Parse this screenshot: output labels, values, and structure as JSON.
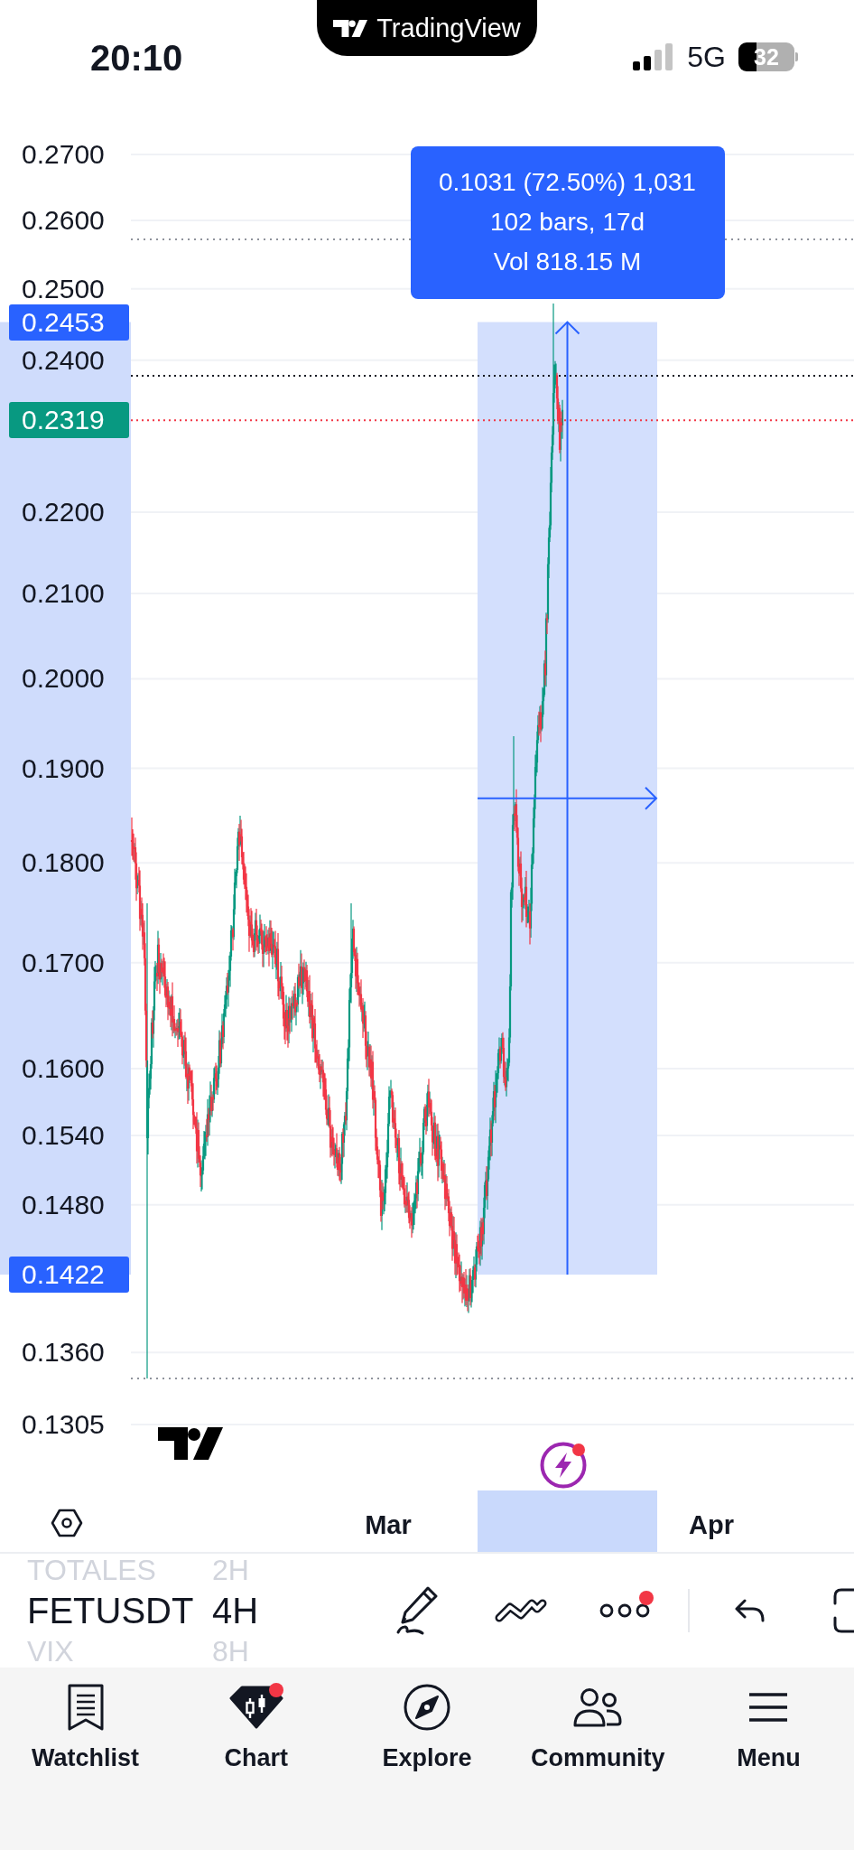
{
  "status_bar": {
    "time": "20:10",
    "app_name": "TradingView",
    "network": "5G",
    "battery": "32"
  },
  "chart": {
    "price_axis": [
      "0.2700",
      "0.2600",
      "0.2500",
      "0.2400",
      "0.2200",
      "0.2100",
      "0.2000",
      "0.1900",
      "0.1800",
      "0.1700",
      "0.1600",
      "0.1540",
      "0.1480",
      "0.1360",
      "0.1305"
    ],
    "price_badges": [
      {
        "label": "0.2453",
        "kind": "range",
        "color": "#2962ff"
      },
      {
        "label": "0.2319",
        "kind": "last",
        "color": "#089981"
      },
      {
        "label": "0.1422",
        "kind": "range",
        "color": "#2962ff"
      }
    ],
    "measure_tooltip": [
      "0.1031 (72.50%) 1,031",
      "102 bars, 17d",
      "Vol 818.15 M"
    ],
    "alerts": {
      "notification": true
    }
  },
  "time_axis": [
    "Mar",
    "Apr"
  ],
  "symbol_bar": {
    "symbols": [
      {
        "label": "TOTALES",
        "selected": false
      },
      {
        "label": "FETUSDT",
        "selected": true
      },
      {
        "label": "VIX",
        "selected": false
      }
    ],
    "intervals": [
      {
        "label": "2H",
        "selected": false
      },
      {
        "label": "4H",
        "selected": true
      },
      {
        "label": "8H",
        "selected": false
      }
    ],
    "tools": [
      {
        "kind": "draw",
        "notification": false
      },
      {
        "kind": "trend",
        "notification": false
      },
      {
        "kind": "more",
        "notification": true
      },
      {
        "kind": "undo",
        "notification": false
      },
      {
        "kind": "fullscreen",
        "notification": false
      }
    ]
  },
  "tab_bar": [
    {
      "label": "Watchlist",
      "selected": false,
      "notification": false
    },
    {
      "label": "Chart",
      "selected": true,
      "notification": true
    },
    {
      "label": "Explore",
      "selected": false,
      "notification": false
    },
    {
      "label": "Community",
      "selected": false,
      "notification": false
    },
    {
      "label": "Menu",
      "selected": false,
      "notification": false
    }
  ]
}
